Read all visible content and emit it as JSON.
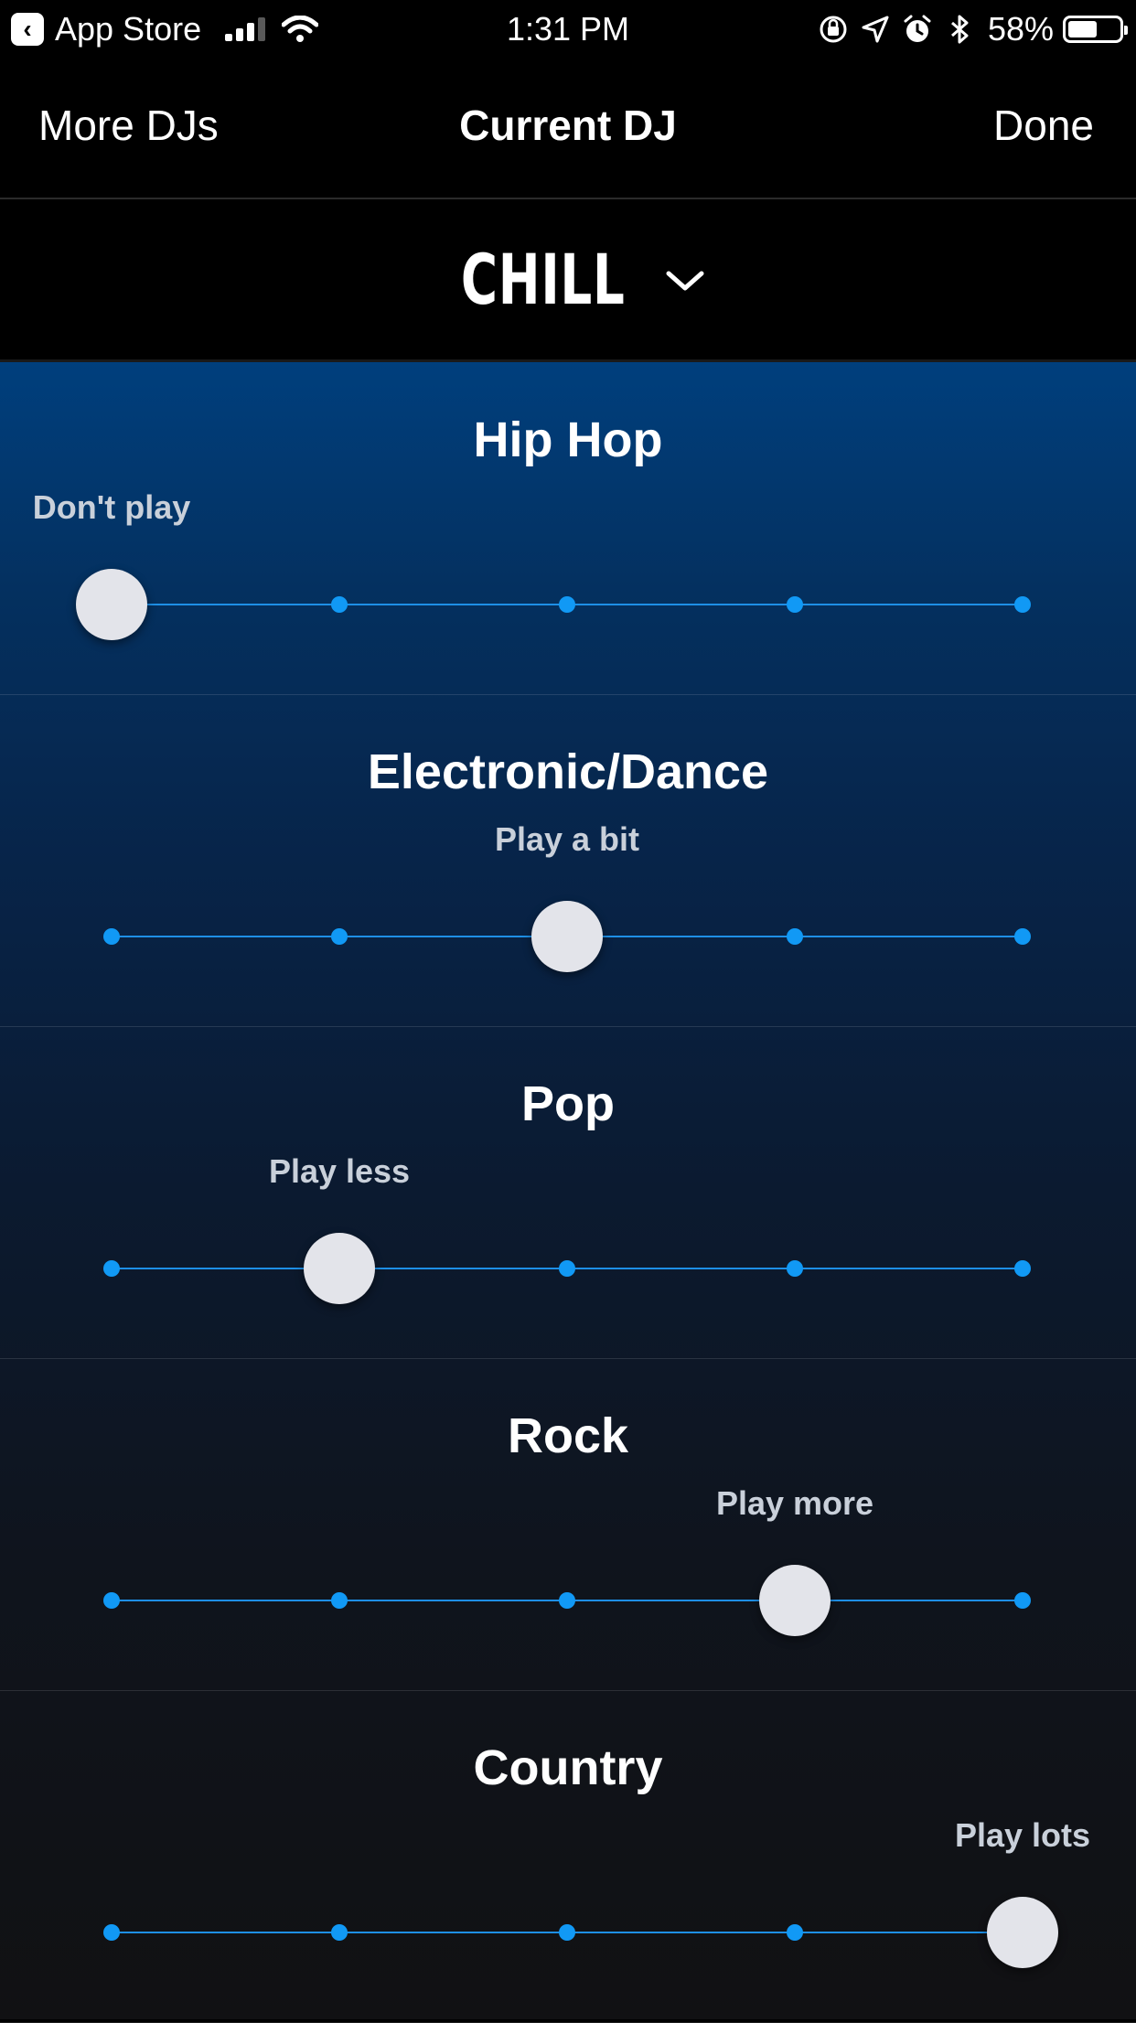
{
  "status_bar": {
    "back_app": "App Store",
    "time": "1:31 PM",
    "battery_percent": "58%",
    "battery_level": 0.58,
    "icons": [
      "back-arrow-icon",
      "cellular-signal-icon",
      "wifi-icon",
      "orientation-lock-icon",
      "location-arrow-icon",
      "alarm-icon",
      "bluetooth-icon",
      "battery-icon"
    ]
  },
  "nav": {
    "left": "More DJs",
    "title": "Current DJ",
    "right": "Done"
  },
  "dj_selector": {
    "name": "CHILL",
    "icon": "chevron-down-icon"
  },
  "slider_levels": [
    "Don't play",
    "Play less",
    "Play a bit",
    "Play more",
    "Play lots"
  ],
  "genres": [
    {
      "name": "Hip Hop",
      "level_index": 0,
      "level_label": "Don't play"
    },
    {
      "name": "Electronic/Dance",
      "level_index": 2,
      "level_label": "Play a bit"
    },
    {
      "name": "Pop",
      "level_index": 1,
      "level_label": "Play less"
    },
    {
      "name": "Rock",
      "level_index": 3,
      "level_label": "Play more"
    },
    {
      "name": "Country",
      "level_index": 4,
      "level_label": "Play lots"
    }
  ],
  "colors": {
    "accent": "#1199f5",
    "thumb": "#e3e4ea",
    "label": "#c9d0da"
  }
}
